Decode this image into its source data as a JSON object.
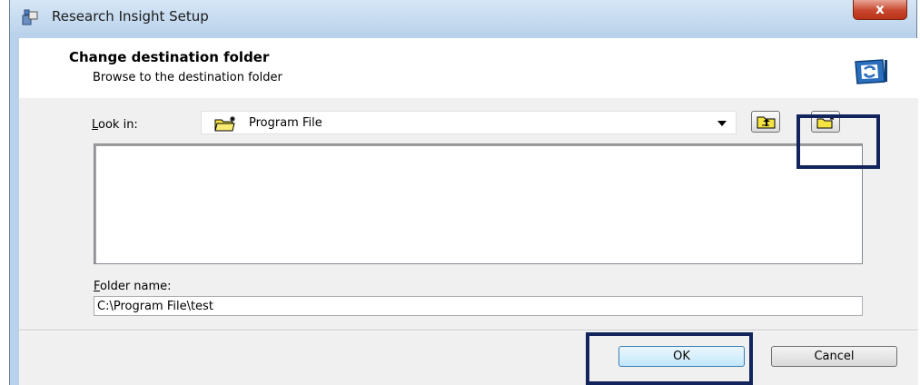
{
  "window": {
    "title": "Research Insight Setup",
    "close_label": "x"
  },
  "header": {
    "title": "Change destination folder",
    "subtitle": "Browse to the destination folder"
  },
  "look_in": {
    "label_accel": "L",
    "label_rest": "ook in:",
    "selected": "Program File"
  },
  "folder_name": {
    "label_accel": "F",
    "label_rest": "older name:",
    "value": "C:\\Program File\\test"
  },
  "buttons": {
    "ok": "OK",
    "cancel": "Cancel"
  },
  "icons": {
    "app": "setup-app-icon",
    "header": "refresh-folder-icon",
    "combo": "new-folder-icon",
    "up": "up-one-level-icon",
    "new": "create-new-folder-icon"
  },
  "colors": {
    "highlight": "#13235c",
    "title_bar": "#bcd4ec",
    "close_button": "#c7472e",
    "folder_yellow": "#f5e342"
  }
}
